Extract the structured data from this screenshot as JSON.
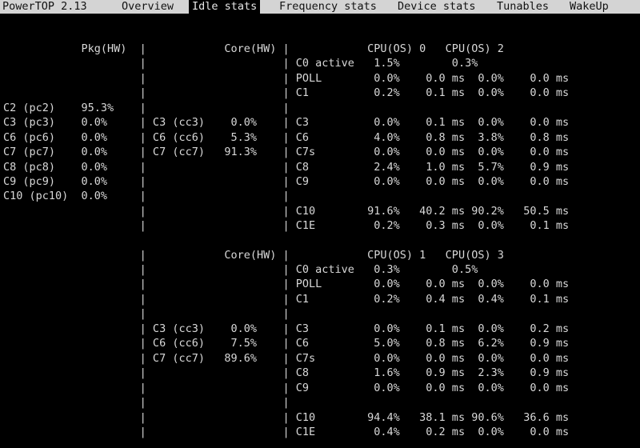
{
  "app_title": "PowerTOP 2.13",
  "tabs": [
    {
      "label": "Overview"
    },
    {
      "label": "Idle stats"
    },
    {
      "label": "Frequency stats"
    },
    {
      "label": "Device stats"
    },
    {
      "label": "Tunables"
    },
    {
      "label": "WakeUp"
    }
  ],
  "block1": [
    "            Pkg(HW)  |            Core(HW) |            CPU(OS) 0   CPU(OS) 2",
    "                     |                     | C0 active   1.5%        0.3%",
    "                     |                     | POLL        0.0%    0.0 ms  0.0%    0.0 ms",
    "                     |                     | C1          0.2%    0.1 ms  0.0%    0.0 ms",
    "C2 (pc2)    95.3%    |                     |",
    "C3 (pc3)    0.0%     | C3 (cc3)    0.0%    | C3          0.0%    0.1 ms  0.0%    0.0 ms",
    "C6 (pc6)    0.0%     | C6 (cc6)    5.3%    | C6          4.0%    0.8 ms  3.8%    0.8 ms",
    "C7 (pc7)    0.0%     | C7 (cc7)   91.3%    | C7s         0.0%    0.0 ms  0.0%    0.0 ms",
    "C8 (pc8)    0.0%     |                     | C8          2.4%    1.0 ms  5.7%    0.9 ms",
    "C9 (pc9)    0.0%     |                     | C9          0.0%    0.0 ms  0.0%    0.0 ms",
    "C10 (pc10)  0.0%     |                     |",
    "                     |                     | C10        91.6%   40.2 ms 90.2%   50.5 ms",
    "                     |                     | C1E         0.2%    0.3 ms  0.0%    0.1 ms"
  ],
  "block2": [
    "                     |            Core(HW) |            CPU(OS) 1   CPU(OS) 3",
    "                     |                     | C0 active   0.3%        0.5%",
    "                     |                     | POLL        0.0%    0.0 ms  0.0%    0.0 ms",
    "                     |                     | C1          0.2%    0.4 ms  0.4%    0.1 ms",
    "                     |                     |",
    "                     | C3 (cc3)    0.0%    | C3          0.0%    0.1 ms  0.0%    0.2 ms",
    "                     | C6 (cc6)    7.5%    | C6          5.0%    0.8 ms  6.2%    0.9 ms",
    "                     | C7 (cc7)   89.6%    | C7s         0.0%    0.0 ms  0.0%    0.0 ms",
    "                     |                     | C8          1.6%    0.9 ms  2.3%    0.9 ms",
    "                     |                     | C9          0.0%    0.0 ms  0.0%    0.0 ms",
    "                     |                     |",
    "                     |                     | C10        94.4%   38.1 ms 90.6%   36.6 ms",
    "                     |                     | C1E         0.4%    0.2 ms  0.0%    0.0 ms"
  ]
}
